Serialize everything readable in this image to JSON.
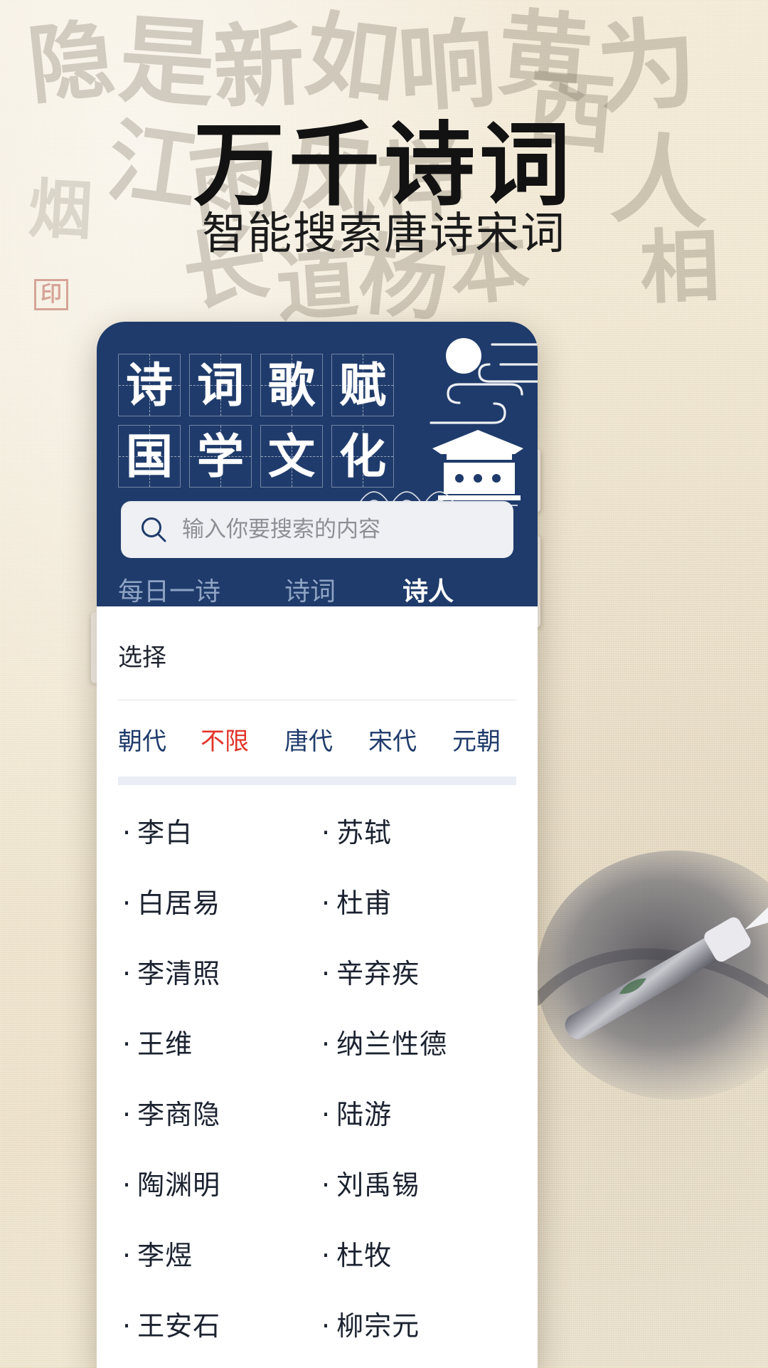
{
  "hero": {
    "title": "万千诗词",
    "subtitle": "智能搜索唐诗宋词"
  },
  "colors": {
    "navy": "#1f3b6b",
    "accent_red": "#e2342a",
    "paper": "#ece0c8",
    "tab_inactive": "#8fa4c4",
    "search_bg": "#eef0f4"
  },
  "watermarks": [
    "隐",
    "是",
    "新",
    "如",
    "响",
    "黄",
    "为",
    "江",
    "雨",
    "风",
    "样",
    "人",
    "长",
    "杨",
    "道",
    "烟",
    "本",
    "西",
    "相"
  ],
  "app": {
    "header": {
      "grid_chars": [
        "诗",
        "词",
        "歌",
        "赋",
        "国",
        "学",
        "文",
        "化"
      ],
      "decor_icons": [
        "moon-icon",
        "cloud-line-icon",
        "pavilion-icon",
        "mountain-wave-icon"
      ]
    },
    "search": {
      "icon": "search-icon",
      "placeholder": "输入你要搜索的内容",
      "value": ""
    },
    "tabs": [
      {
        "label": "每日一诗",
        "active": false
      },
      {
        "label": "诗词",
        "active": false
      },
      {
        "label": "诗人",
        "active": true
      }
    ],
    "content": {
      "section_title": "选择",
      "filter": {
        "label": "朝代",
        "options": [
          {
            "label": "不限",
            "active": true
          },
          {
            "label": "唐代",
            "active": false
          },
          {
            "label": "宋代",
            "active": false
          },
          {
            "label": "元朝",
            "active": false
          }
        ]
      },
      "poets": [
        "李白",
        "苏轼",
        "白居易",
        "杜甫",
        "李清照",
        "辛弃疾",
        "王维",
        "纳兰性德",
        "李商隐",
        "陆游",
        "陶渊明",
        "刘禹锡",
        "李煜",
        "杜牧",
        "王安石",
        "柳宗元"
      ],
      "bullet": "·"
    }
  }
}
